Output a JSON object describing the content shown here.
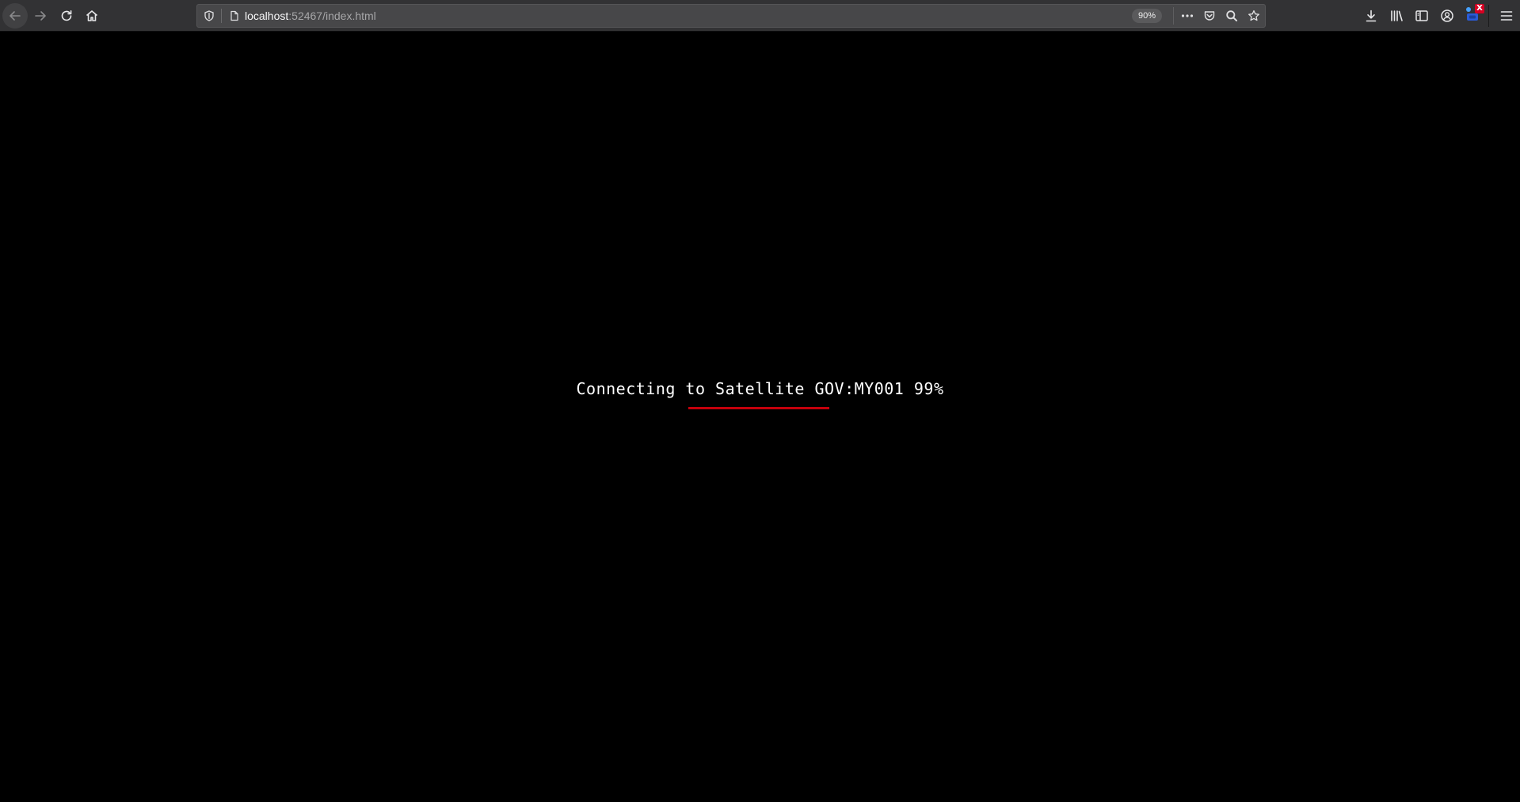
{
  "browser": {
    "url_host": "localhost",
    "url_path": ":52467/index.html",
    "zoom_level": "90%",
    "icons": {
      "back": "arrow-left-icon",
      "forward": "arrow-right-icon",
      "reload": "reload-icon",
      "home": "home-icon",
      "tracking_protection": "shield-icon",
      "page_info": "page-icon",
      "page_actions": "more-icon",
      "pocket": "pocket-icon",
      "search": "search-icon",
      "bookmark": "star-icon",
      "downloads": "download-icon",
      "library": "library-icon",
      "sidebar": "sidebar-icon",
      "account": "account-icon",
      "extension": "extension-icon",
      "menu": "hamburger-menu-icon"
    },
    "extension_badge": "X"
  },
  "loader": {
    "message": "Connecting to Satellite GOV:MY001 99%",
    "progress": 0.99,
    "bar_color": "#c4000b"
  },
  "colors": {
    "page_background": "#000000",
    "toolbar_background": "#323234",
    "urlbar_background": "#474749"
  }
}
